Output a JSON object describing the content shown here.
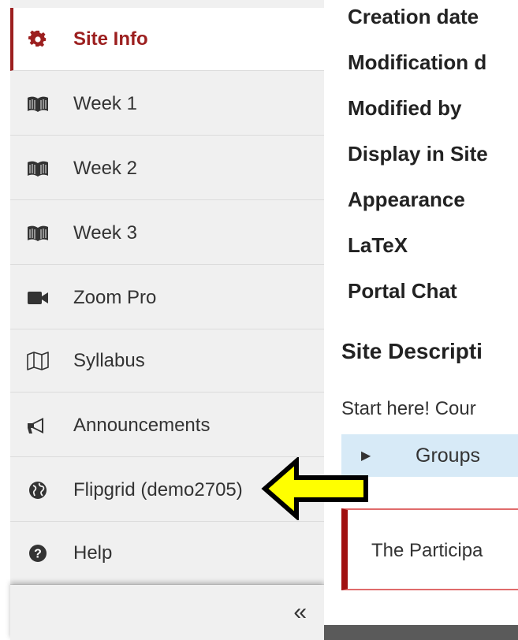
{
  "sidebar": {
    "items": [
      {
        "label": "Site Info",
        "icon": "gear-icon",
        "active": true
      },
      {
        "label": "Week 1",
        "icon": "book-icon"
      },
      {
        "label": "Week 2",
        "icon": "book-icon"
      },
      {
        "label": "Week 3",
        "icon": "book-icon"
      },
      {
        "label": "Zoom Pro",
        "icon": "video-camera-icon"
      },
      {
        "label": "Syllabus",
        "icon": "map-icon"
      },
      {
        "label": "Announcements",
        "icon": "bullhorn-icon"
      },
      {
        "label": "Flipgrid (demo2705)",
        "icon": "globe-icon"
      },
      {
        "label": "Help",
        "icon": "question-circle-icon"
      }
    ],
    "collapse_glyph": "«"
  },
  "main": {
    "fields": [
      "Creation date",
      "Modification d",
      "Modified by",
      "Display in Site",
      "Appearance",
      "LaTeX",
      "Portal Chat"
    ],
    "section_title": "Site Descripti",
    "description": "Start here!  Cour",
    "groups_label": "Groups",
    "alert_text": "The Participa"
  },
  "colors": {
    "accent": "#9c1f1f",
    "arrow": "#ffff00",
    "groups_bg": "#d7eaf7"
  }
}
